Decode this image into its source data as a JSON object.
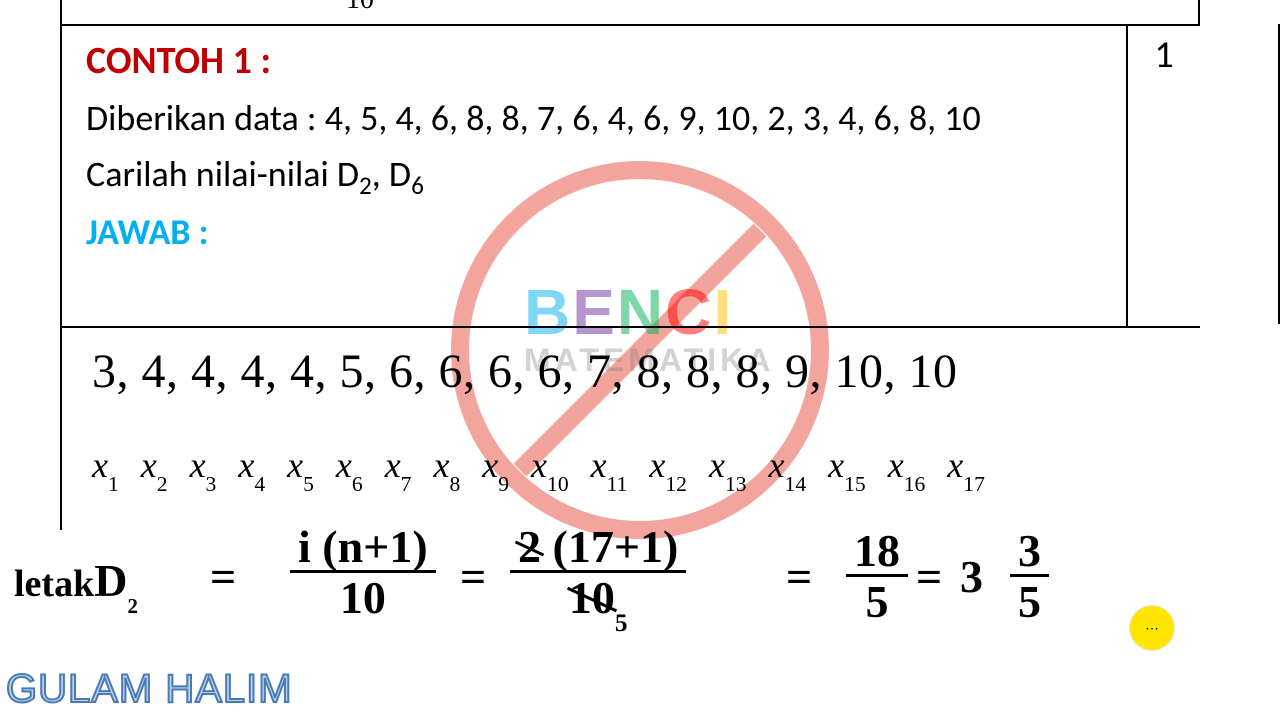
{
  "top_fragment": "10",
  "problem": {
    "heading": "CONTOH 1 :",
    "given_label": "Diberikan data :",
    "data_raw": "4, 5, 4, 6, 8, 8, 7, 6, 4, 6, 9, 10, 2, 3, 4, 6, 8, 10",
    "task_prefix": "Carilah nilai-nilai ",
    "task_d1": "D",
    "task_d1_sub": "2",
    "task_sep": ", ",
    "task_d2": "D",
    "task_d2_sub": "6",
    "answer_label": "JAWAB :",
    "page_num": "1"
  },
  "sorted_data": "3, 4, 4, 4, 4, 5, 6, 6, 6, 6, 7, 8, 8, 8, 9, 10, 10",
  "x_labels": [
    "x₁",
    "x₂",
    "x₃",
    "x₄",
    "x₅",
    "x₆",
    "x₇",
    "x₈",
    "x₉",
    "x₁₀",
    "x₁₁",
    "x₁₂",
    "x₁₃",
    "x₁₄",
    "x₁₅",
    "x₁₆",
    "x₁₇"
  ],
  "handwriting": {
    "letak": "letak",
    "D": "D",
    "D_sub": "2",
    "eq": "=",
    "f1_n": "i (n+1)",
    "f1_d": "10",
    "f2_n_strike": "2",
    "f2_n_rest": " (17+1)",
    "f2_d_strike": "10",
    "f2_d_sub": "5",
    "f3_n": "18",
    "f3_d": "5",
    "whole": "3",
    "f4_n": "3",
    "f4_d": "5"
  },
  "watermark": {
    "line1": "BENCI",
    "line2": "MATEMATIKA"
  },
  "author": "GULAM HALIM",
  "cursor": "⋯"
}
